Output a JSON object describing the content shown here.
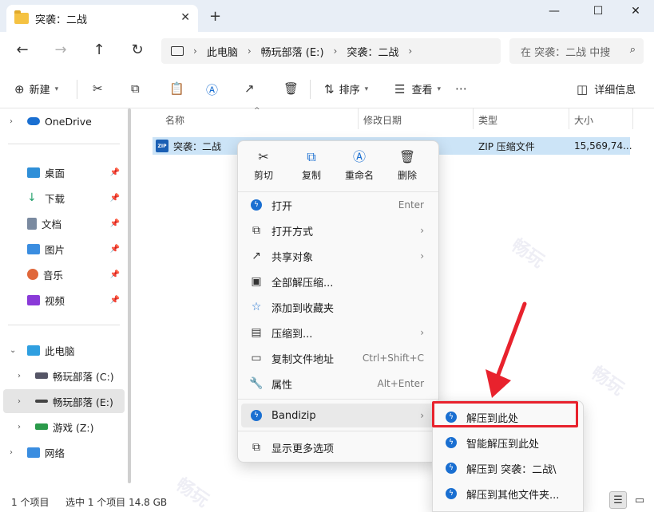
{
  "window": {
    "tab_title": "突袭：二战",
    "tab_close": "✕",
    "new_tab": "+",
    "minimize": "—",
    "maximize": "☐",
    "close": "✕"
  },
  "nav": {
    "back": "←",
    "forward": "→",
    "up": "↑",
    "refresh": "↻",
    "breadcrumbs": [
      "此电脑",
      "畅玩部落 (E:)",
      "突袭：二战"
    ],
    "sep": "›",
    "search_placeholder": "在 突袭：二战 中搜",
    "search_icon": "⌕"
  },
  "toolbar": {
    "new_label": "新建",
    "sort_label": "排序",
    "view_label": "查看",
    "details_label": "详细信息"
  },
  "sidebar": {
    "onedrive": "OneDrive",
    "quick_access": [
      {
        "label": "桌面",
        "icon": "desktop-icon",
        "color": "#2f8fd8"
      },
      {
        "label": "下载",
        "icon": "download-icon",
        "color": "#22a06b"
      },
      {
        "label": "文档",
        "icon": "document-icon",
        "color": "#7a8aa0"
      },
      {
        "label": "图片",
        "icon": "pictures-icon",
        "color": "#3a8de0"
      },
      {
        "label": "音乐",
        "icon": "music-icon",
        "color": "#e0673a"
      },
      {
        "label": "视频",
        "icon": "video-icon",
        "color": "#8a3ad8"
      }
    ],
    "this_pc": "此电脑",
    "drives": [
      {
        "label": "畅玩部落 (C:)",
        "selected": false
      },
      {
        "label": "畅玩部落 (E:)",
        "selected": true
      },
      {
        "label": "游戏 (Z:)",
        "selected": false
      }
    ],
    "network": "网络"
  },
  "columns": {
    "name": "名称",
    "modified": "修改日期",
    "type": "类型",
    "size": "大小"
  },
  "files": [
    {
      "name": "突袭：二战",
      "type": "ZIP 压缩文件",
      "size": "15,569,74...",
      "icon_text": "ZIP"
    }
  ],
  "status": {
    "count": "1 个项目",
    "selected": "选中 1 个项目  14.8 GB"
  },
  "context_menu": {
    "quick_actions": [
      {
        "label": "剪切",
        "icon": "cut-icon",
        "glyph": "✂"
      },
      {
        "label": "复制",
        "icon": "copy-icon",
        "glyph": "⧉"
      },
      {
        "label": "重命名",
        "icon": "rename-icon",
        "glyph": "Ⓐ"
      },
      {
        "label": "删除",
        "icon": "delete-icon",
        "glyph": "🗑"
      }
    ],
    "items": [
      {
        "label": "打开",
        "shortcut": "Enter",
        "arrow": false
      },
      {
        "label": "打开方式",
        "shortcut": "",
        "arrow": true
      },
      {
        "label": "共享对象",
        "shortcut": "",
        "arrow": true
      },
      {
        "label": "全部解压缩...",
        "shortcut": "",
        "arrow": false
      },
      {
        "label": "添加到收藏夹",
        "shortcut": "",
        "arrow": false
      },
      {
        "label": "压缩到...",
        "shortcut": "",
        "arrow": true
      },
      {
        "label": "复制文件地址",
        "shortcut": "Ctrl+Shift+C",
        "arrow": false
      },
      {
        "label": "属性",
        "shortcut": "Alt+Enter",
        "arrow": false
      }
    ],
    "bandizip": "Bandizip",
    "more_options": "显示更多选项"
  },
  "submenu": {
    "items": [
      "解压到此处",
      "智能解压到此处",
      "解压到 突袭：二战\\",
      "解压到其他文件夹..."
    ]
  },
  "colors": {
    "accent": "#1a6fd1",
    "selection": "#cce4f7",
    "highlight_red": "#e8222d"
  }
}
